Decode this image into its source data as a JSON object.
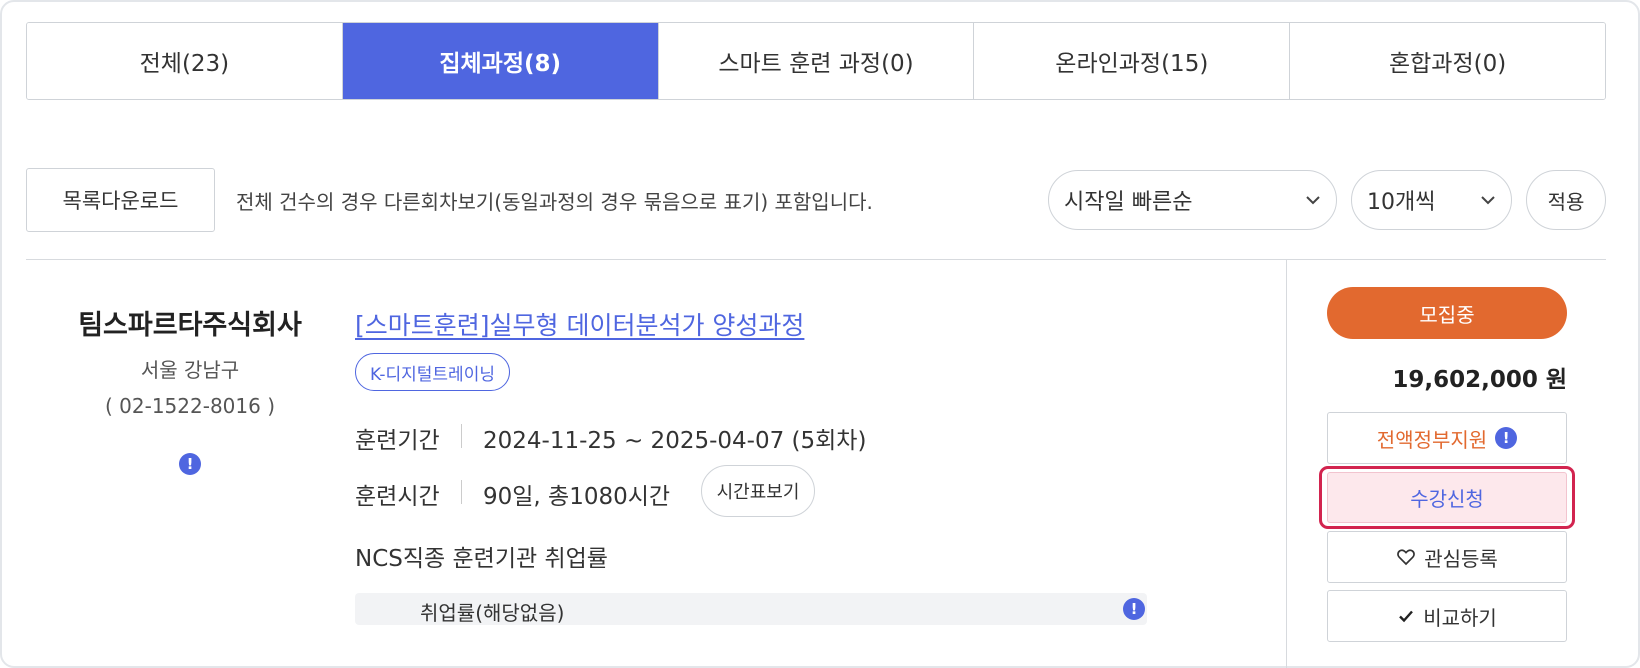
{
  "tabs": [
    {
      "label": "전체(23)",
      "active": false
    },
    {
      "label": "집체과정(8)",
      "active": true
    },
    {
      "label": "스마트 훈련 과정(0)",
      "active": false
    },
    {
      "label": "온라인과정(15)",
      "active": false
    },
    {
      "label": "혼합과정(0)",
      "active": false
    }
  ],
  "toolbar": {
    "download_label": "목록다운로드",
    "notice": "전체 건수의 경우 다른회차보기(동일과정의 경우 묶음으로 표기) 포함입니다.",
    "sort_value": "시작일 빠른순",
    "count_value": "10개씩",
    "apply_label": "적용"
  },
  "org": {
    "name": "팀스파르타주식회사",
    "location": "서울 강남구",
    "phone": "( 02-1522-8016 )",
    "info_icon": "!"
  },
  "course": {
    "title": "[스마트훈련]실무형 데이터분석가 양성과정",
    "tag": "K-디지털트레이닝",
    "period_label": "훈련기간",
    "period_value": "2024-11-25 ~ 2025-04-07 (5회차)",
    "hours_label": "훈련시간",
    "hours_value": "90일, 총1080시간",
    "timetable_label": "시간표보기",
    "ncs_label": "NCS직종 훈련기관 취업률",
    "employment_text": "취업률(해당없음)",
    "info_icon": "!"
  },
  "actions": {
    "status": "모집중",
    "price": "19,602,000 원",
    "support_label": "전액정부지원",
    "support_icon": "!",
    "apply_label": "수강신청",
    "favorite_label": "관심등록",
    "compare_label": "비교하기"
  },
  "colors": {
    "accent": "#4f66e0",
    "status": "#e2692f",
    "highlight": "#d2244f"
  }
}
